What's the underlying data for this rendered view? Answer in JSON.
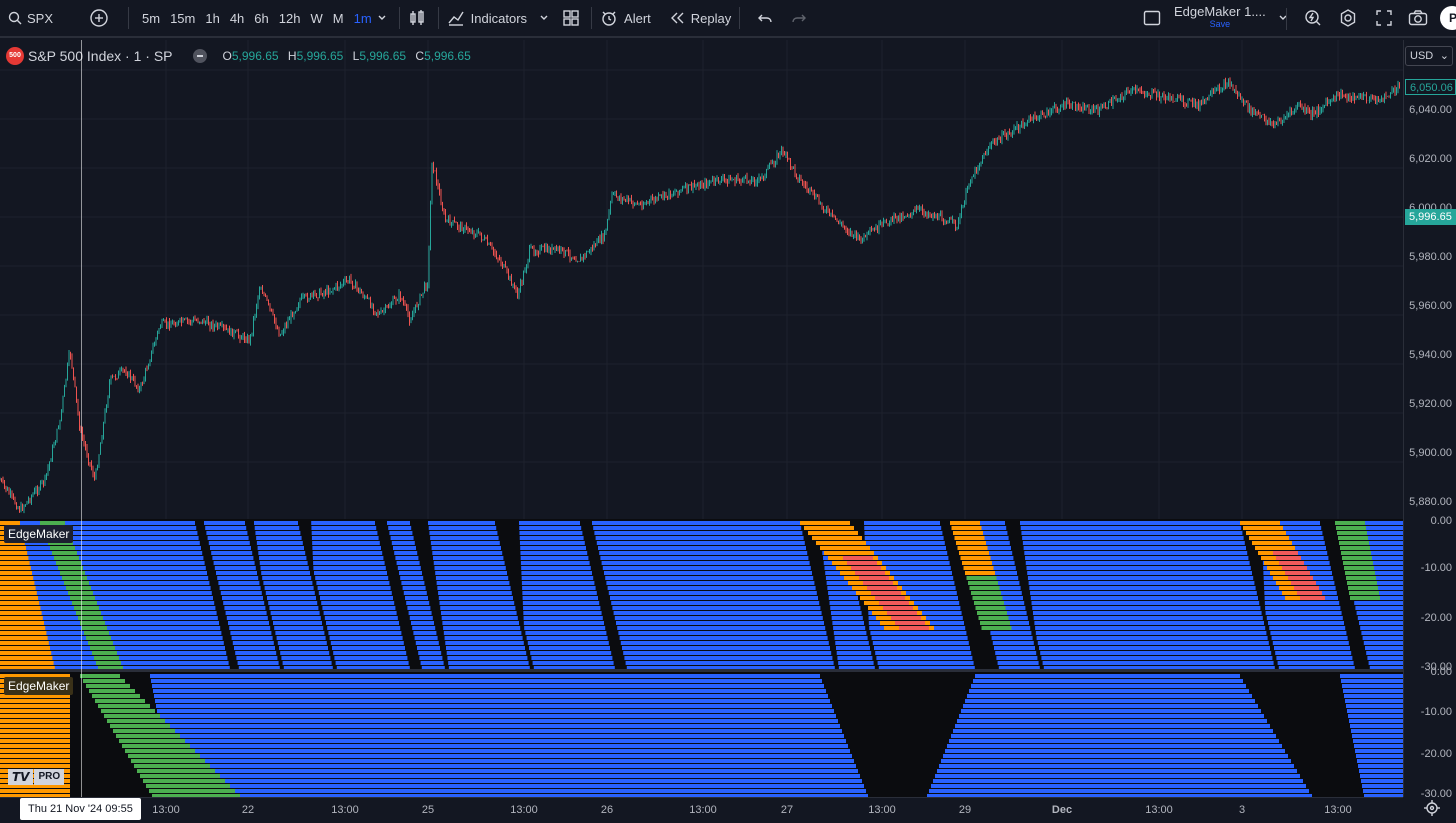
{
  "toolbar": {
    "symbol": "SPX",
    "intervals": [
      "5m",
      "15m",
      "1h",
      "4h",
      "6h",
      "12h",
      "W",
      "M",
      "1m"
    ],
    "active_interval": "1m",
    "indicators_label": "Indicators",
    "alert_label": "Alert",
    "replay_label": "Replay",
    "layout_name": "EdgeMaker 1....",
    "layout_save": "Save",
    "avatar_letter": "P"
  },
  "legend": {
    "badge": "500",
    "title": "S&P 500 Index · 1 · SP",
    "o_key": "O",
    "o": "5,996.65",
    "h_key": "H",
    "h": "5,996.65",
    "l_key": "L",
    "l": "5,996.65",
    "c_key": "C",
    "c": "5,996.65"
  },
  "price_axis": {
    "currency": "USD",
    "ticks": [
      "6,040.00",
      "6,020.00",
      "6,000.00",
      "5,980.00",
      "5,960.00",
      "5,940.00",
      "5,920.00",
      "5,900.00",
      "5,880.00"
    ],
    "last_price": "6,050.06",
    "current_price": "5,996.65",
    "colors": {
      "last": "#26a69a",
      "current": "#26a69a",
      "up": "#26a69a",
      "down": "#ef5350"
    }
  },
  "indicator_axis": {
    "pane1_ticks": [
      "0.00",
      "-10.00",
      "-20.00",
      "-30.00"
    ],
    "pane2_ticks": [
      "0.00",
      "-10.00",
      "-20.00",
      "-30.00"
    ]
  },
  "panes": {
    "pane1_label": "EdgeMaker",
    "pane2_label": "EdgeMaker",
    "colors": {
      "blue": "#2962ff",
      "orange": "#ff9800",
      "red": "#f15a5a",
      "green": "#4caf50",
      "black": "#0b0c0f"
    }
  },
  "time_axis": {
    "labels": [
      "13:00",
      "22",
      "13:00",
      "25",
      "13:00",
      "26",
      "13:00",
      "27",
      "13:00",
      "29",
      "Dec",
      "13:00",
      "3",
      "13:00"
    ],
    "bold": [
      false,
      false,
      false,
      false,
      false,
      false,
      false,
      false,
      false,
      false,
      true,
      false,
      false,
      false
    ],
    "crosshair_label": "Thu 21 Nov '24   09:55"
  },
  "logo": {
    "brand": "TV",
    "tier": "PRO"
  }
}
